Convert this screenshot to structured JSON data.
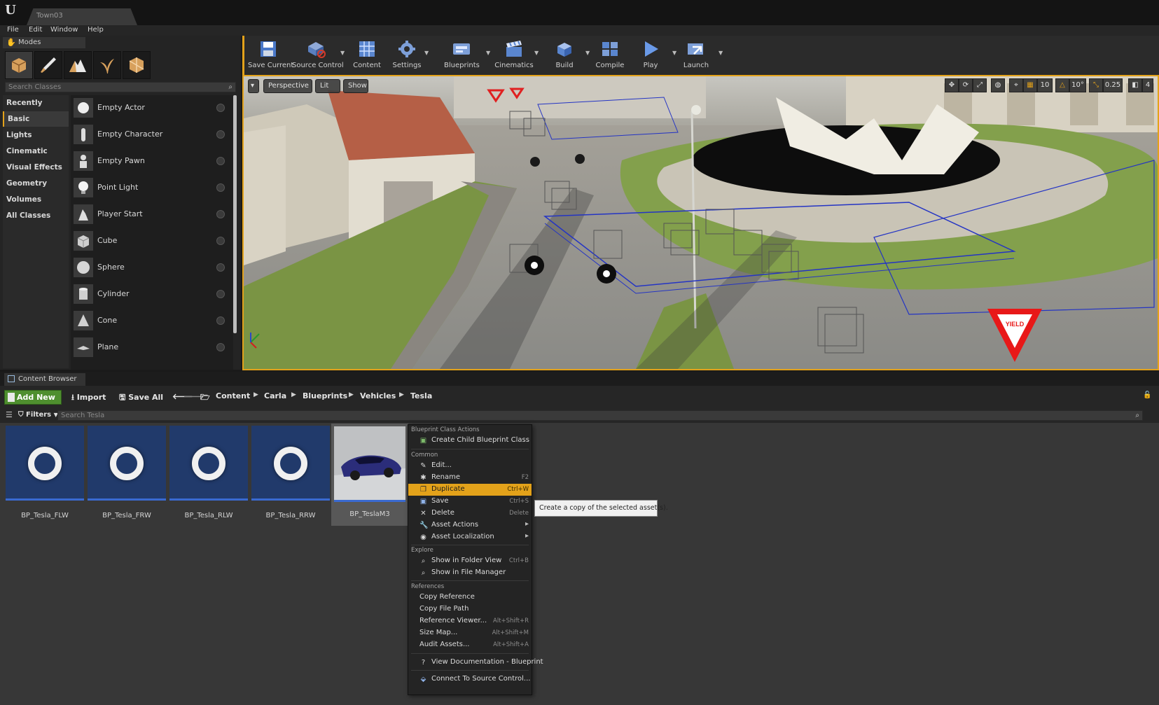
{
  "window": {
    "tab_title": "Town03"
  },
  "menu": [
    "File",
    "Edit",
    "Window",
    "Help"
  ],
  "modes": {
    "tab_label": "Modes",
    "search_placeholder": "Search Classes",
    "categories": [
      "Recently Placed",
      "Basic",
      "Lights",
      "Cinematic",
      "Visual Effects",
      "Geometry",
      "Volumes",
      "All Classes"
    ],
    "selected_category": "Basic",
    "classes": [
      "Empty Actor",
      "Empty Character",
      "Empty Pawn",
      "Point Light",
      "Player Start",
      "Cube",
      "Sphere",
      "Cylinder",
      "Cone",
      "Plane"
    ]
  },
  "toolbar": {
    "save_current": "Save Current",
    "source_control": "Source Control",
    "content": "Content",
    "settings": "Settings",
    "blueprints": "Blueprints",
    "cinematics": "Cinematics",
    "build": "Build",
    "compile": "Compile",
    "play": "Play",
    "launch": "Launch"
  },
  "viewport": {
    "perspective": "Perspective",
    "lit": "Lit",
    "show": "Show",
    "grid_snap": "10",
    "rotation_snap": "10°",
    "scale_snap": "0.25",
    "camera_speed": "4",
    "yield_text": "YIELD"
  },
  "content_browser": {
    "tab_label": "Content Browser",
    "add_new": "Add New",
    "import": "Import",
    "save_all": "Save All",
    "breadcrumb": [
      "Content",
      "Carla",
      "Blueprints",
      "Vehicles",
      "Tesla"
    ],
    "filters": "Filters",
    "search_placeholder": "Search Tesla",
    "assets": [
      "BP_Tesla_FLW",
      "BP_Tesla_FRW",
      "BP_Tesla_RLW",
      "BP_Tesla_RRW",
      "BP_TeslaM3"
    ],
    "selected_asset": "BP_TeslaM3"
  },
  "context_menu": {
    "section_blueprint": "Blueprint Class Actions",
    "create_child": "Create Child Blueprint Class",
    "section_common": "Common",
    "edit": "Edit...",
    "rename": "Rename",
    "rename_shortcut": "F2",
    "duplicate": "Duplicate",
    "duplicate_shortcut": "Ctrl+W",
    "save": "Save",
    "save_shortcut": "Ctrl+S",
    "delete": "Delete",
    "delete_shortcut": "Delete",
    "asset_actions": "Asset Actions",
    "asset_localization": "Asset Localization",
    "section_explore": "Explore",
    "show_folder": "Show in Folder View",
    "show_folder_shortcut": "Ctrl+B",
    "show_file_manager": "Show in File Manager",
    "section_references": "References",
    "copy_reference": "Copy Reference",
    "copy_file_path": "Copy File Path",
    "reference_viewer": "Reference Viewer...",
    "reference_viewer_shortcut": "Alt+Shift+R",
    "size_map": "Size Map...",
    "size_map_shortcut": "Alt+Shift+M",
    "audit_assets": "Audit Assets...",
    "audit_assets_shortcut": "Alt+Shift+A",
    "view_docs": "View Documentation - Blueprint",
    "connect_source_control": "Connect To Source Control...",
    "tooltip": "Create a copy of the selected asset(s)."
  },
  "colors": {
    "accent": "#e3a21a",
    "add_new": "#4f8f2f",
    "asset_tile": "#213a6b"
  }
}
